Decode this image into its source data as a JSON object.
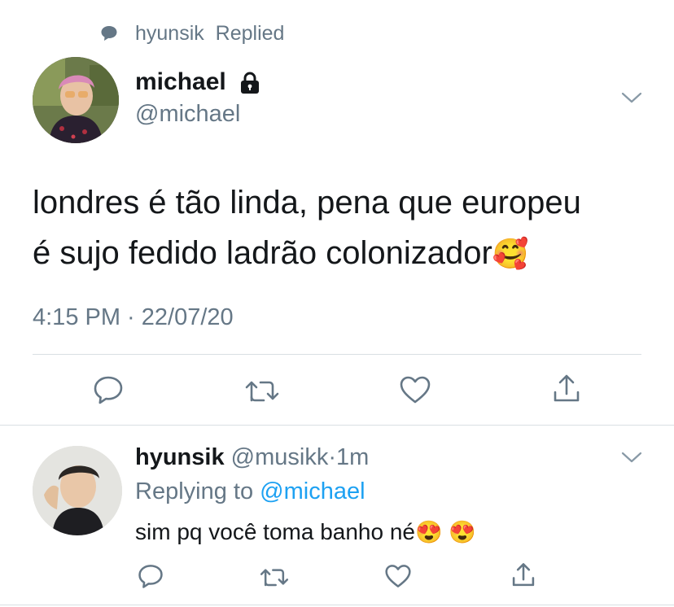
{
  "context": {
    "replied_name": "hyunsik",
    "replied_label": "Replied"
  },
  "main_tweet": {
    "display_name": "michael",
    "handle": "@michael",
    "text_line1": "londres é tão linda, pena que europeu",
    "text_line2": "é sujo fedido ladrão colonizador",
    "emoji": "🥰",
    "timestamp": "4:15 PM · 22/07/20"
  },
  "reply_tweet": {
    "display_name": "hyunsik",
    "handle": "@musikk",
    "time": "1m",
    "replying_prefix": "Replying to",
    "replying_handle": "@michael",
    "text": "sim pq você toma banho né",
    "emoji": "😍 😍"
  },
  "icons": [
    "comment-icon",
    "lock-icon",
    "chevron-down-icon",
    "reply-icon",
    "retweet-icon",
    "like-icon",
    "share-icon"
  ]
}
